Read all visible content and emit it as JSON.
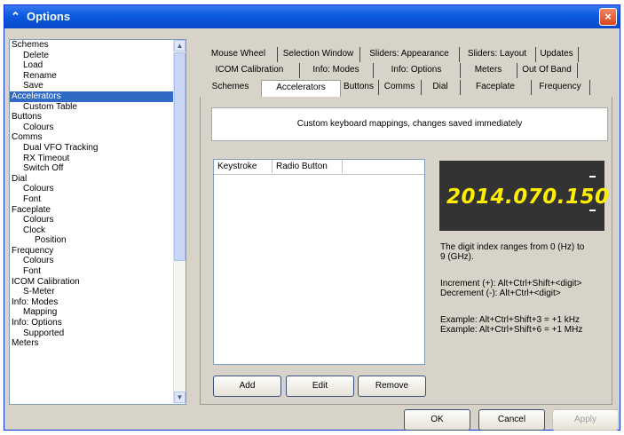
{
  "window": {
    "title": "Options",
    "icon": "radio-antenna-icon",
    "close_label": "×"
  },
  "tree": {
    "items": [
      {
        "label": "Schemes",
        "level": 0
      },
      {
        "label": "Delete",
        "level": 1
      },
      {
        "label": "Load",
        "level": 1
      },
      {
        "label": "Rename",
        "level": 1
      },
      {
        "label": "Save",
        "level": 1
      },
      {
        "label": "Accelerators",
        "level": 0,
        "selected": true
      },
      {
        "label": "Custom Table",
        "level": 1
      },
      {
        "label": "Buttons",
        "level": 0
      },
      {
        "label": "Colours",
        "level": 1
      },
      {
        "label": "Comms",
        "level": 0
      },
      {
        "label": "Dual VFO Tracking",
        "level": 1
      },
      {
        "label": "RX Timeout",
        "level": 1
      },
      {
        "label": "Switch Off",
        "level": 1
      },
      {
        "label": "Dial",
        "level": 0
      },
      {
        "label": "Colours",
        "level": 1
      },
      {
        "label": "Font",
        "level": 1
      },
      {
        "label": "Faceplate",
        "level": 0
      },
      {
        "label": "Colours",
        "level": 1
      },
      {
        "label": "Clock",
        "level": 1
      },
      {
        "label": "Position",
        "level": 2
      },
      {
        "label": "Frequency",
        "level": 0
      },
      {
        "label": "Colours",
        "level": 1
      },
      {
        "label": "Font",
        "level": 1
      },
      {
        "label": "ICOM Calibration",
        "level": 0
      },
      {
        "label": "S-Meter",
        "level": 1
      },
      {
        "label": "Info: Modes",
        "level": 0
      },
      {
        "label": "Mapping",
        "level": 1
      },
      {
        "label": "Info: Options",
        "level": 0
      },
      {
        "label": "Supported",
        "level": 1
      },
      {
        "label": "Meters",
        "level": 0
      }
    ]
  },
  "tabs": {
    "row1": [
      {
        "label": "Mouse Wheel",
        "w": 87
      },
      {
        "label": "Selection Window",
        "w": 93
      },
      {
        "label": "Sliders: Appearance",
        "w": 112
      },
      {
        "label": "Sliders: Layout",
        "w": 86
      },
      {
        "label": "Updates",
        "w": 48
      }
    ],
    "row2": [
      {
        "label": "ICOM Calibration",
        "w": 112
      },
      {
        "label": "Info: Modes",
        "w": 83
      },
      {
        "label": "Info: Options",
        "w": 98
      },
      {
        "label": "Meters",
        "w": 64
      },
      {
        "label": "Out Of Band",
        "w": 68
      }
    ],
    "row3": [
      {
        "label": "Schemes",
        "w": 69
      },
      {
        "label": "Accelerators",
        "w": 88,
        "active": true
      },
      {
        "label": "Buttons",
        "w": 44
      },
      {
        "label": "Comms",
        "w": 48
      },
      {
        "label": "Dial",
        "w": 44
      },
      {
        "label": "Faceplate",
        "w": 80
      },
      {
        "label": "Frequency",
        "w": 66
      }
    ]
  },
  "panel": {
    "info": "Custom keyboard mappings, changes saved immediately",
    "columns": [
      "Keystroke",
      "Radio Button"
    ],
    "add": "Add",
    "edit": "Edit",
    "remove": "Remove",
    "frequency": "2014.070.150",
    "help_index": [
      "The digit index ranges from 0 (Hz) to",
      "9 (GHz)."
    ],
    "increment": "Increment (+):  Alt+Ctrl+Shift+<digit>",
    "decrement": "Decrement (-):  Alt+Ctrl+<digit>",
    "example1": "Example:  Alt+Ctrl+Shift+3  =  +1 kHz",
    "example2": "Example:  Alt+Ctrl+Shift+6  =  +1 MHz"
  },
  "buttons": {
    "ok": "OK",
    "cancel": "Cancel",
    "apply": "Apply"
  },
  "colors": {
    "titlebar": "#0b5ae0",
    "selection": "#316ac5",
    "display_bg": "#333333",
    "display_digits": "#ffee00"
  }
}
